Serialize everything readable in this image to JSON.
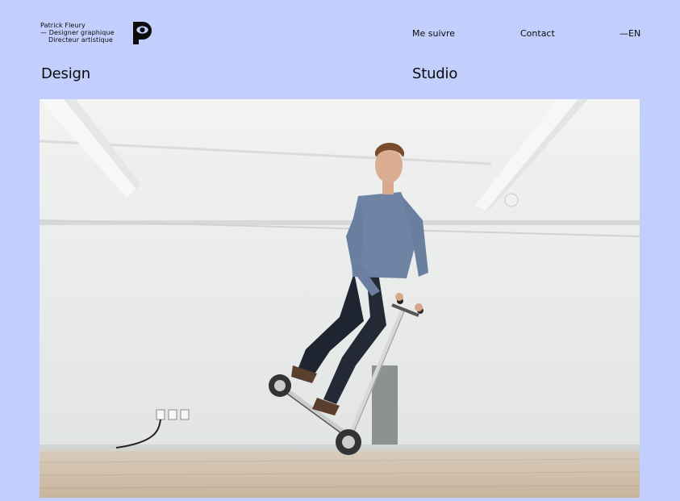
{
  "brand": {
    "name_line": "Patrick Fleury",
    "role_line1": "— Designer graphique",
    "role_line2": "Directeur artistique"
  },
  "nav": {
    "follow": "Me suivre",
    "contact": "Contact",
    "lang": "—EN"
  },
  "sections": {
    "design": "Design",
    "studio": "Studio"
  },
  "colors": {
    "background": "#c2cffd",
    "text": "#0b0b0b"
  },
  "hero": {
    "subject": "man-on-kick-scooter-photo"
  }
}
